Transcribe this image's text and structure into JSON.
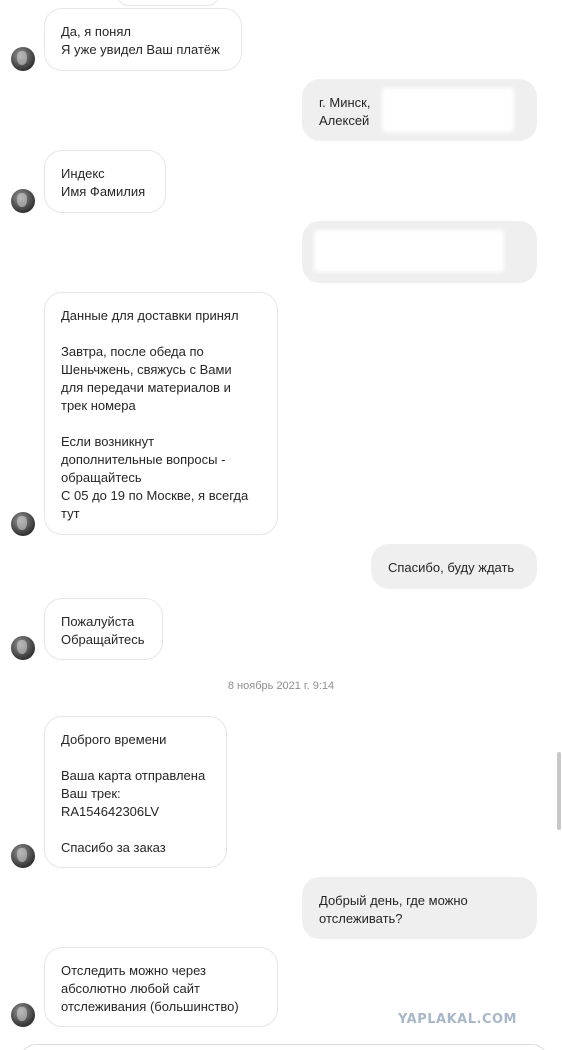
{
  "messages": [
    {
      "side": "in",
      "text": "Да, я понял\nЯ уже увидел Ваш платёж"
    },
    {
      "side": "out",
      "text": "г. Минск,\nАлексей"
    },
    {
      "side": "in",
      "text": "Индекс\nИмя Фамилия"
    },
    {
      "side": "out",
      "text": ""
    },
    {
      "side": "in",
      "text": "Данные для доставки принял\n\nЗавтра, после обеда по\nШеньчжень, свяжусь с Вами\nдля передачи материалов и\nтрек номера\n\nЕсли возникнут\nдополнительные вопросы -\nобращайтесь\nС 05 до 19 по Москве, я всегда\nтут"
    },
    {
      "side": "out",
      "text": "Спасибо, буду ждать"
    },
    {
      "side": "in",
      "text": "Пожалуйста\nОбращайтесь"
    },
    {
      "side": "in",
      "text": "Доброго времени\n\nВаша карта отправлена\nВаш трек:\nRA154642306LV\n\nСпасибо за заказ"
    },
    {
      "side": "out",
      "text": "Добрый день, где можно\nотслеживать?"
    },
    {
      "side": "in",
      "text": "Отследить можно через\nабсолютно любой сайт\nотслеживания (большинство)"
    }
  ],
  "timestamp": "8 ноябрь 2021 г. 9:14",
  "watermark": "YAPLAKAL.COM"
}
